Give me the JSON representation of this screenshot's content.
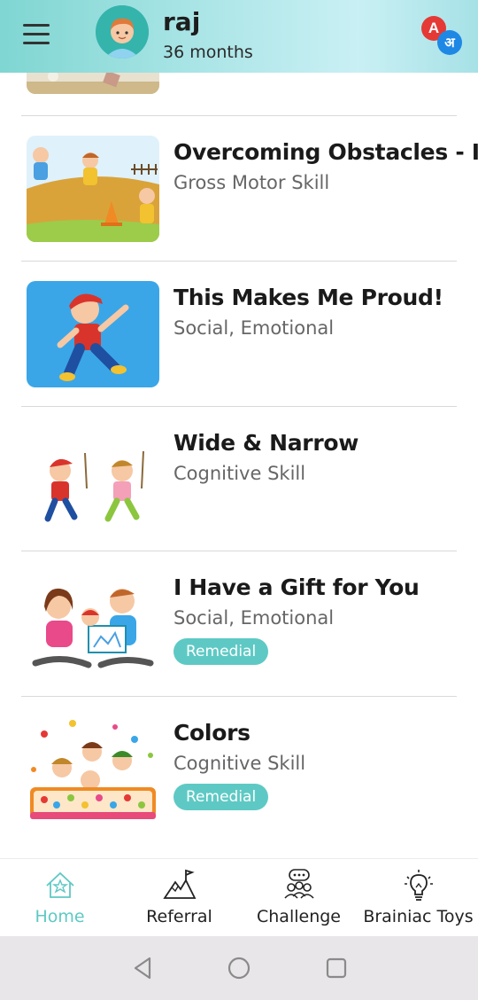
{
  "header": {
    "menu_icon": "hamburger-menu-icon",
    "user_name": "raj",
    "user_age": "36 months",
    "language_icon": {
      "letter_en": "A",
      "letter_hi": "अ"
    }
  },
  "activities": [
    {
      "title": "Overcoming Obstacles - I",
      "category": "Gross Motor Skill",
      "badge": ""
    },
    {
      "title": "This Makes Me Proud!",
      "category": "Social, Emotional",
      "badge": ""
    },
    {
      "title": "Wide & Narrow",
      "category": "Cognitive Skill",
      "badge": ""
    },
    {
      "title": "I Have a Gift for You",
      "category": "Social, Emotional",
      "badge": "Remedial"
    },
    {
      "title": "Colors",
      "category": "Cognitive Skill",
      "badge": "Remedial"
    }
  ],
  "bottom_nav": {
    "items": [
      {
        "label": "Home",
        "icon": "home-icon",
        "active": true
      },
      {
        "label": "Referral",
        "icon": "mountain-flag-icon",
        "active": false
      },
      {
        "label": "Challenge",
        "icon": "group-chat-icon",
        "active": false
      },
      {
        "label": "Brainiac Toys",
        "icon": "lightbulb-icon",
        "active": false
      }
    ]
  },
  "colors": {
    "accent": "#5ec9c4",
    "header_start": "#7fd6d2",
    "header_end": "#c9f0f4"
  },
  "system_nav": {
    "icons": [
      "back-icon",
      "home-circle-icon",
      "recents-icon"
    ]
  }
}
